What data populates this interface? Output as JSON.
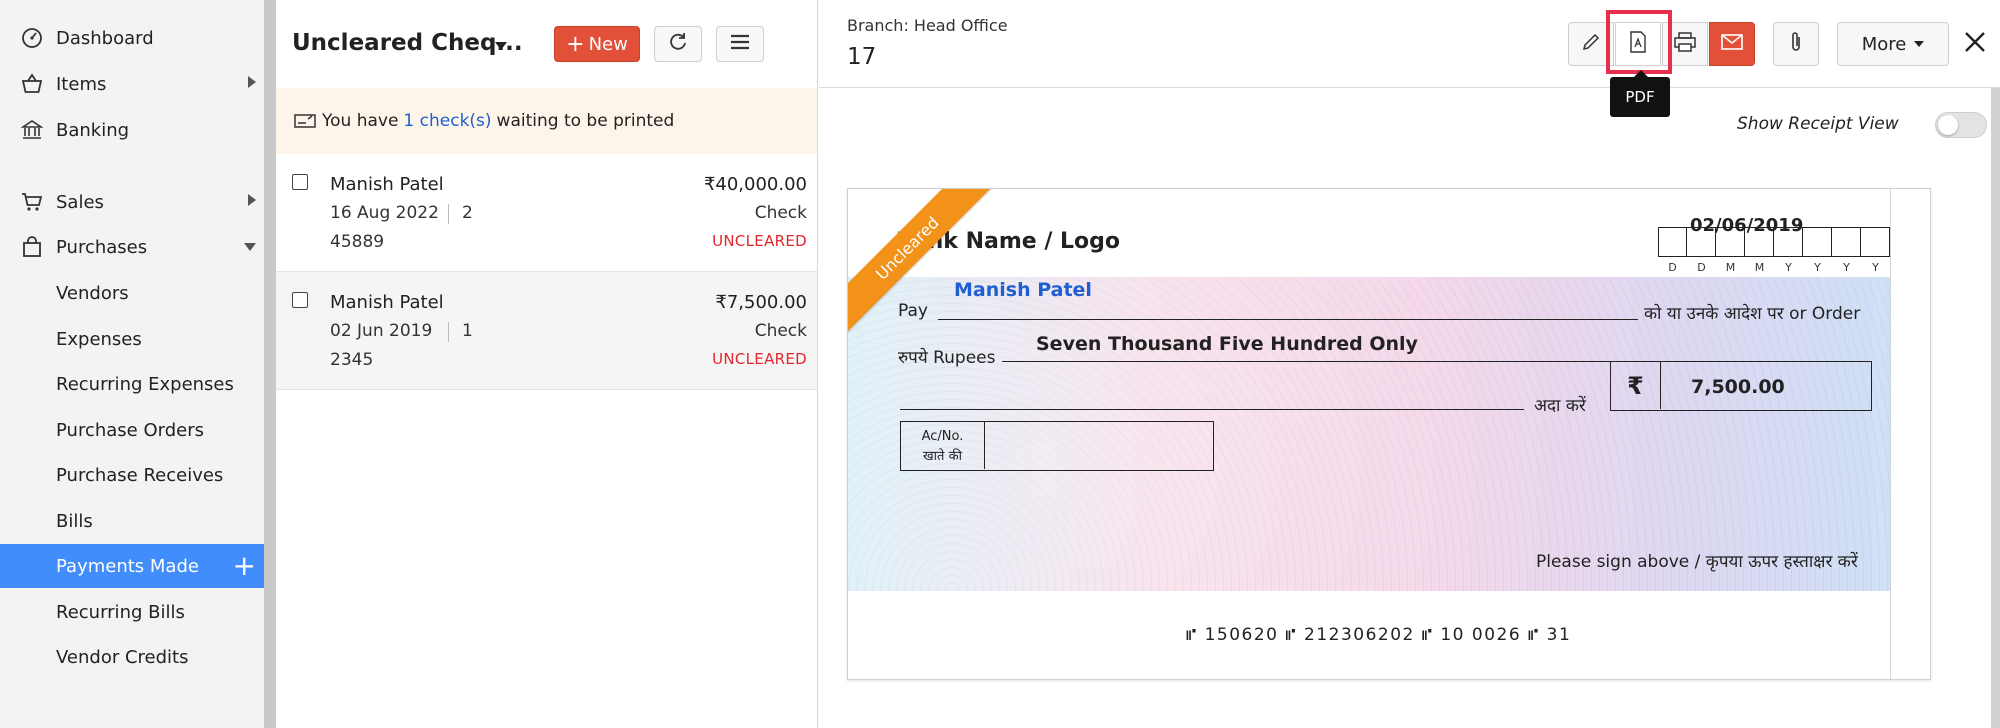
{
  "sidebar": {
    "items": [
      {
        "label": "Dashboard",
        "icon": "dashboard-icon"
      },
      {
        "label": "Items",
        "icon": "basket-icon"
      },
      {
        "label": "Banking",
        "icon": "bank-icon"
      },
      {
        "label": "Sales",
        "icon": "cart-icon"
      },
      {
        "label": "Purchases",
        "icon": "bag-icon"
      }
    ],
    "purchases_sub": [
      "Vendors",
      "Expenses",
      "Recurring Expenses",
      "Purchase Orders",
      "Purchase Receives",
      "Bills",
      "Payments Made",
      "Recurring Bills",
      "Vendor Credits"
    ],
    "active": "Payments Made"
  },
  "list": {
    "title": "Uncleared Cheq...",
    "new_label": "New",
    "banner": {
      "prefix": "You have",
      "link": "1 check(s)",
      "suffix": "waiting to be printed"
    },
    "rows": [
      {
        "name": "Manish Patel",
        "date": "16 Aug 2022",
        "count": "2",
        "ref": "45889",
        "amount": "₹40,000.00",
        "mode": "Check",
        "status": "UNCLEARED"
      },
      {
        "name": "Manish Patel",
        "date": "02 Jun 2019",
        "count": "1",
        "ref": "2345",
        "amount": "₹7,500.00",
        "mode": "Check",
        "status": "UNCLEARED"
      }
    ]
  },
  "detail": {
    "branch": "Branch: Head Office",
    "number": "17",
    "tooltip": "PDF",
    "more_label": "More",
    "receipt_toggle_label": "Show Receipt View",
    "cheque": {
      "ribbon": "Uncleared",
      "bank_name": "Bank Name / Logo",
      "date": "02/06/2019",
      "date_letters": [
        "D",
        "D",
        "M",
        "M",
        "Y",
        "Y",
        "Y",
        "Y"
      ],
      "pay_label": "Pay",
      "payee": "Manish Patel",
      "pay_suffix": "को या उनके आदेश पर or Order",
      "rupees_label": "रुपये Rupees",
      "amount_words": "Seven Thousand Five Hundred Only",
      "ada_label": "अदा करें",
      "currency_symbol": "₹",
      "amount": "7,500.00",
      "acno_label_en": "Ac/No.",
      "acno_label_hi": "खाते की",
      "sign_text": "Please sign above / कृपया ऊपर हस्ताक्षर करें",
      "micr": "⑈ 150620 ⑈ 212306202 ⑈ 10 0026 ⑈ 31"
    }
  },
  "colors": {
    "accent_blue": "#408dfb",
    "new_button_red": "#e2503a",
    "status_red": "#e3252c",
    "link_blue": "#1f5fd1",
    "ribbon_orange": "#f29219",
    "highlight": "#e62e4d"
  }
}
